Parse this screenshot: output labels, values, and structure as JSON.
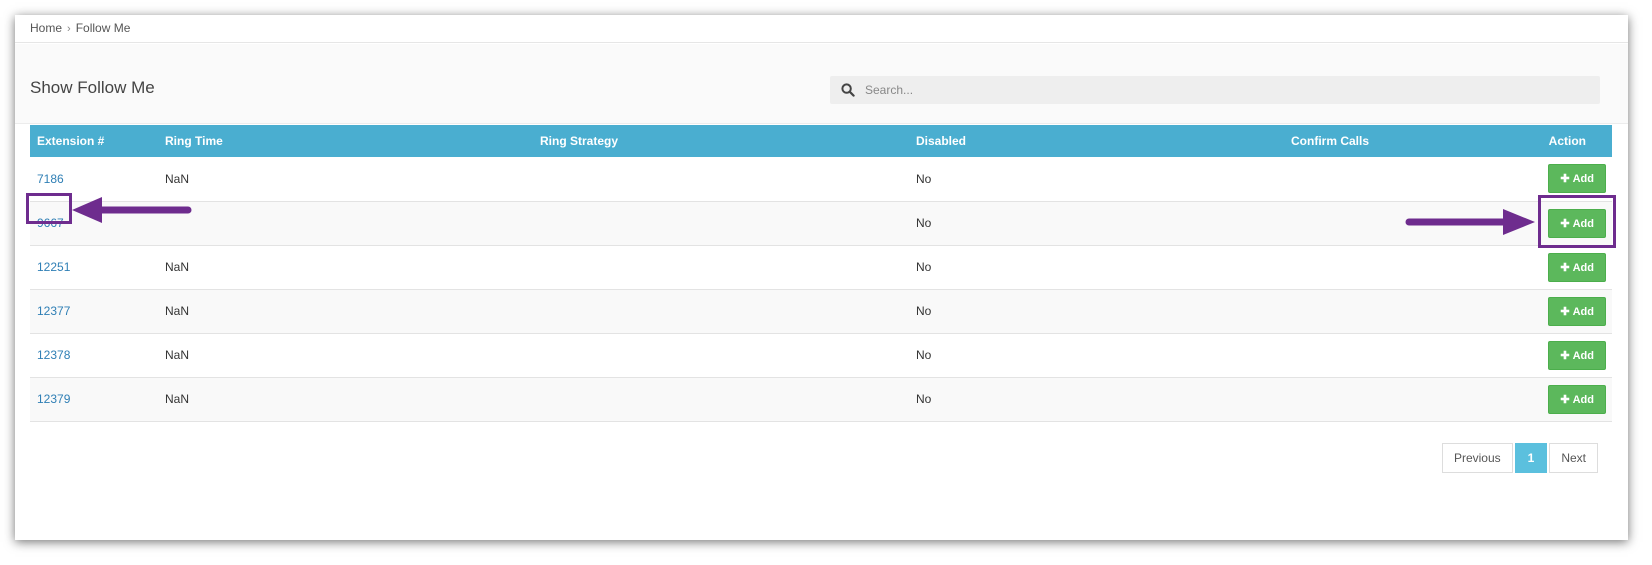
{
  "breadcrumb": {
    "home": "Home",
    "separator": "›",
    "current": "Follow Me"
  },
  "page": {
    "title": "Show Follow Me"
  },
  "search": {
    "placeholder": "Search...",
    "icon": "search-icon"
  },
  "table": {
    "headers": [
      "Extension #",
      "Ring Time",
      "Ring Strategy",
      "Disabled",
      "Confirm Calls",
      "Action"
    ],
    "rows": [
      {
        "extension": "7186",
        "ring_time": "NaN",
        "ring_strategy": "",
        "disabled": "No",
        "confirm_calls": "",
        "action": "Add"
      },
      {
        "extension": "9667",
        "ring_time": "",
        "ring_strategy": "",
        "disabled": "No",
        "confirm_calls": "",
        "action": "Add"
      },
      {
        "extension": "12251",
        "ring_time": "NaN",
        "ring_strategy": "",
        "disabled": "No",
        "confirm_calls": "",
        "action": "Add"
      },
      {
        "extension": "12377",
        "ring_time": "NaN",
        "ring_strategy": "",
        "disabled": "No",
        "confirm_calls": "",
        "action": "Add"
      },
      {
        "extension": "12378",
        "ring_time": "NaN",
        "ring_strategy": "",
        "disabled": "No",
        "confirm_calls": "",
        "action": "Add"
      },
      {
        "extension": "12379",
        "ring_time": "NaN",
        "ring_strategy": "",
        "disabled": "No",
        "confirm_calls": "",
        "action": "Add"
      }
    ]
  },
  "pagination": {
    "previous": "Previous",
    "current": "1",
    "next": "Next"
  },
  "colors": {
    "header": "#4aaed0",
    "add_button": "#5cb85c",
    "link": "#2f7fb5",
    "annotation": "#6e2c8e",
    "active_page": "#5bc0de"
  }
}
